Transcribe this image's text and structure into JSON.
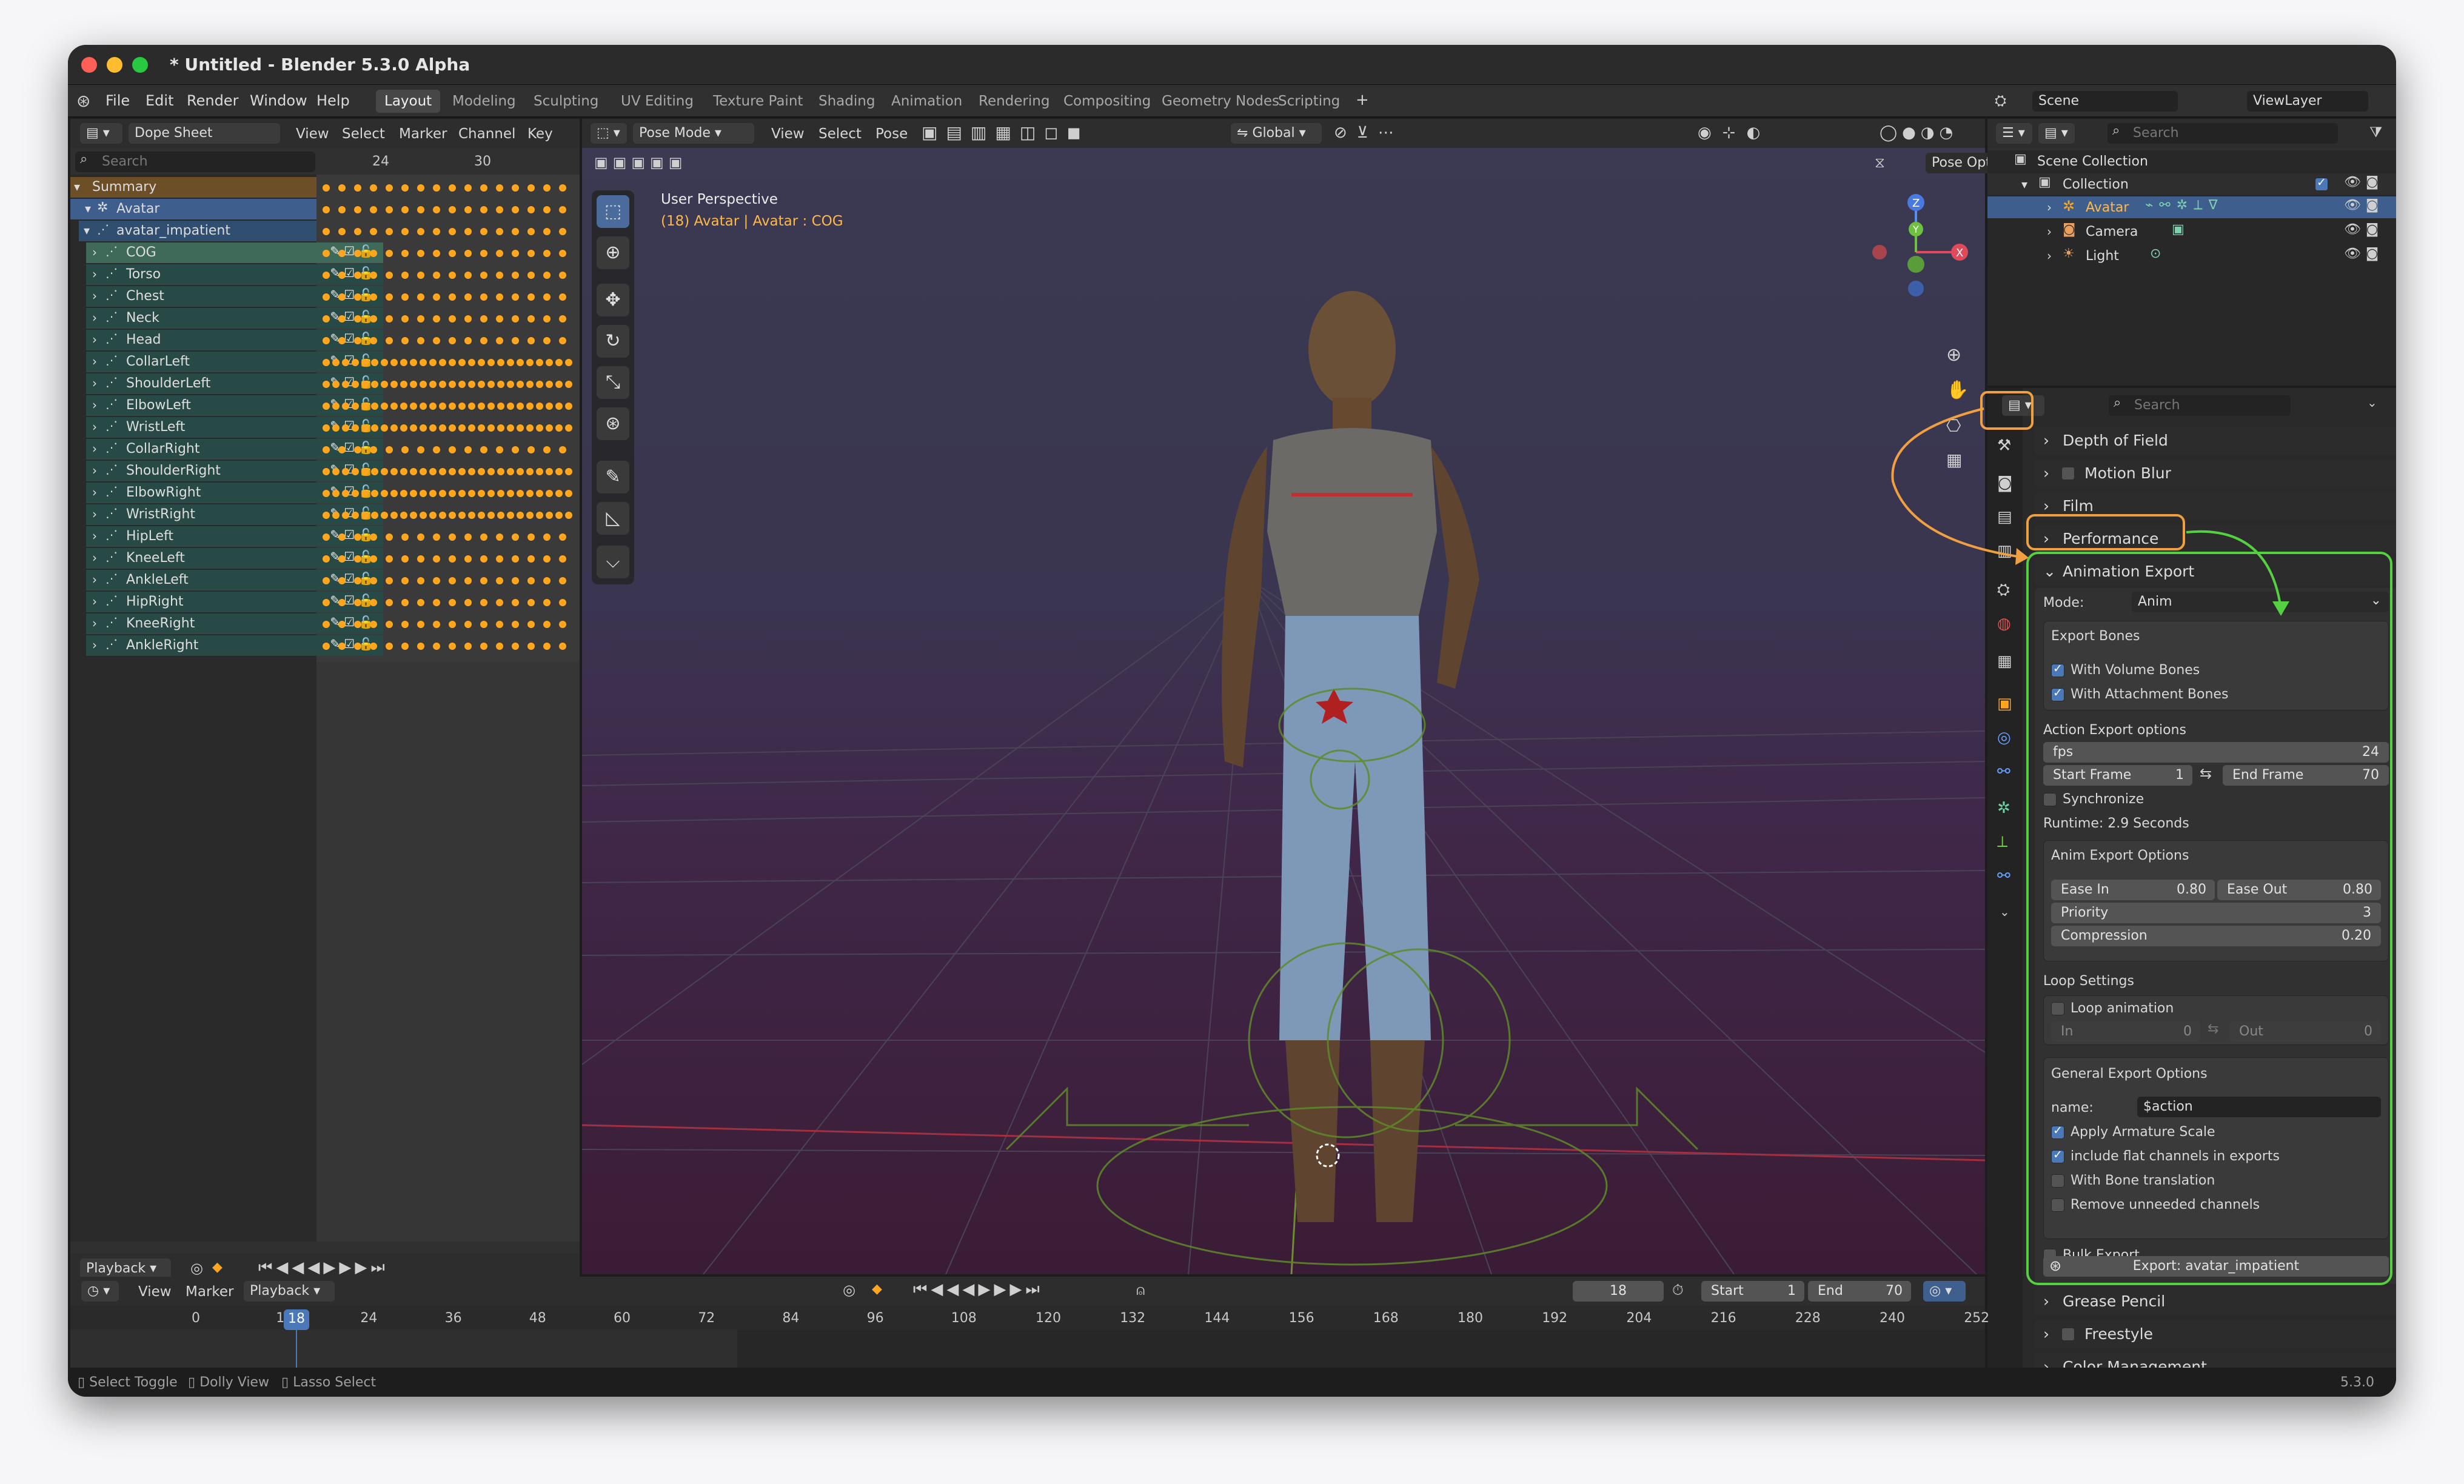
{
  "window": {
    "title": "* Untitled - Blender 5.3.0 Alpha"
  },
  "menu": [
    "File",
    "Edit",
    "Render",
    "Window",
    "Help"
  ],
  "workspaces": [
    {
      "label": "Layout",
      "active": true
    },
    {
      "label": "Modeling"
    },
    {
      "label": "Sculpting"
    },
    {
      "label": "UV Editing"
    },
    {
      "label": "Texture Paint"
    },
    {
      "label": "Shading"
    },
    {
      "label": "Animation"
    },
    {
      "label": "Rendering"
    },
    {
      "label": "Compositing"
    },
    {
      "label": "Geometry Nodes"
    },
    {
      "label": "Scripting"
    }
  ],
  "scene": {
    "name": "Scene",
    "view_layer": "ViewLayer"
  },
  "dopesheet": {
    "editor": "Dope Sheet",
    "menu": [
      "View",
      "Select",
      "Marker",
      "Channel",
      "Key"
    ],
    "search_placeholder": "Search",
    "frame_labels": [
      "24",
      "30"
    ],
    "summary": "Summary",
    "object": "Avatar",
    "action": "avatar_impatient",
    "channels": [
      "COG",
      "Torso",
      "Chest",
      "Neck",
      "Head",
      "CollarLeft",
      "ShoulderLeft",
      "ElbowLeft",
      "WristLeft",
      "CollarRight",
      "ShoulderRight",
      "ElbowRight",
      "WristRight",
      "HipLeft",
      "KneeLeft",
      "AnkleLeft",
      "HipRight",
      "KneeRight",
      "AnkleRight"
    ],
    "playback": "Playback"
  },
  "viewport": {
    "mode": "Pose Mode",
    "menu": [
      "View",
      "Select",
      "Pose"
    ],
    "orientation": "Global",
    "pose_options": "Pose Options",
    "perspective": "User Perspective",
    "context": "(18) Avatar | Avatar : COG"
  },
  "timeline": {
    "menu": [
      "View",
      "Marker",
      "Playback"
    ],
    "current_frame": "18",
    "start_label": "Start",
    "start": "1",
    "end_label": "End",
    "end": "70",
    "ruler": [
      "0",
      "12",
      "18",
      "24",
      "36",
      "48",
      "60",
      "72",
      "84",
      "96",
      "108",
      "120",
      "132",
      "144",
      "156",
      "168",
      "180",
      "192",
      "204",
      "216",
      "228",
      "240",
      "252"
    ]
  },
  "status": {
    "left": [
      "Select Toggle",
      "Dolly View",
      "Lasso Select"
    ],
    "version": "5.3.0"
  },
  "outliner": {
    "search_placeholder": "Search",
    "root": "Scene Collection",
    "collection": "Collection",
    "items": [
      "Avatar",
      "Camera",
      "Light"
    ]
  },
  "properties": {
    "search_placeholder": "Search",
    "sections_top": [
      "Depth of Field",
      "Motion Blur",
      "Film",
      "Performance"
    ],
    "export_title": "Animation Export",
    "mode_label": "Mode:",
    "mode_value": "Anim",
    "export_bones_title": "Export Bones",
    "with_volume_bones": "With Volume Bones",
    "with_attachment_bones": "With Attachment Bones",
    "action_export_title": "Action Export options",
    "fps_label": "fps",
    "fps_value": "24",
    "start_frame_label": "Start Frame",
    "start_frame": "1",
    "end_frame_label": "End Frame",
    "end_frame": "70",
    "synchronize": "Synchronize",
    "runtime": "Runtime: 2.9 Seconds",
    "anim_export_title": "Anim Export Options",
    "ease_in_label": "Ease In",
    "ease_in": "0.80",
    "ease_out_label": "Ease Out",
    "ease_out": "0.80",
    "priority_label": "Priority",
    "priority": "3",
    "compression_label": "Compression",
    "compression": "0.20",
    "loop_title": "Loop Settings",
    "loop_animation": "Loop animation",
    "in_label": "In",
    "in_value": "0",
    "out_label": "Out",
    "out_value": "0",
    "general_title": "General Export Options",
    "name_label": "name:",
    "name_value": "$action",
    "apply_armature_scale": "Apply Armature Scale",
    "include_flat": "include flat channels in exports",
    "with_bone_translation": "With Bone translation",
    "remove_unneeded": "Remove unneeded channels",
    "bulk_export": "Bulk Export",
    "export_button": "Export: avatar_impatient",
    "sections_bottom": [
      "Grease Pencil",
      "Freestyle",
      "Color Management"
    ]
  },
  "colors": {
    "accent": "#4b78b8",
    "keyframe": "#ffa51e",
    "annotation_orange": "#f0a040",
    "annotation_green": "#55d040"
  }
}
